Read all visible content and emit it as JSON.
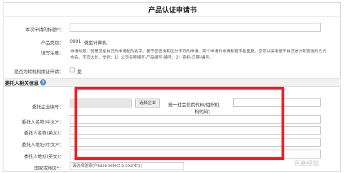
{
  "form": {
    "title": "产品认证申请书",
    "apply_title_label": "本次申请的标题*：",
    "product_category_label": "产品类别：",
    "product_category_code": "0901",
    "product_category_name": "微型计算机",
    "note_label": "填写注意：",
    "note_text": "申请标题：就是您给自己的申请起的名字，便于您查询和区分不同的申请，两个申请的申请标题不能重复。您可以采用便于自己统计和查询的方式命名，不宜太长，举例：1）公司名称缩写-产品缩写-编号；2）商标-日期-编号。",
    "transfer_label": "是否为转机构换证申请：",
    "transfer_option": "是"
  },
  "client_section": {
    "title": "委托人相关信息",
    "company_no_label": "委托企业编号：",
    "select_company_button": "选择企业",
    "credit_code_label_1": "统一社会信用代码/组织机",
    "credit_code_label_2": "构代码：",
    "name_cn_label": "委托人名称(中文)*：",
    "name_en_label": "委托人名称(英文)：",
    "addr_cn_label": "委托人地址(中文)*：",
    "addr_en_label": "委托人地址(英文)：",
    "country_label": "国家或地区*：",
    "country_placeholder": "请选择国家(Please select a country)"
  },
  "watermark": "百度经验",
  "colors": {
    "highlight": "#ee1c25",
    "help_icon": "#5b8fd1"
  }
}
